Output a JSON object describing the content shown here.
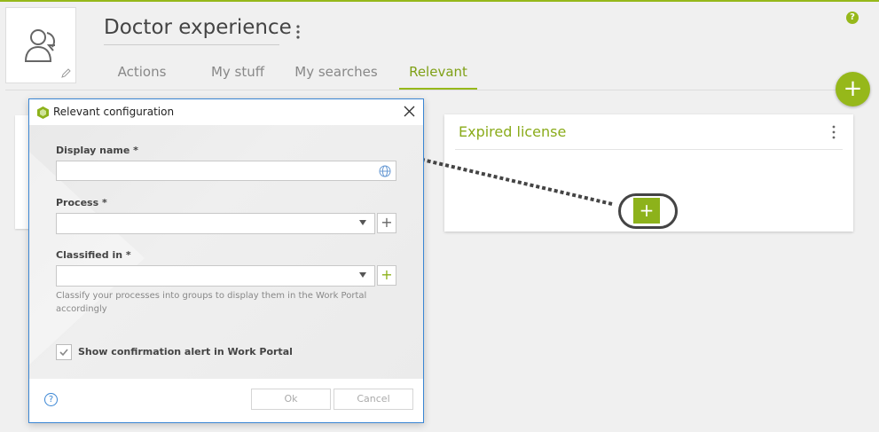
{
  "header": {
    "title": "Doctor experience",
    "help_glyph": "?",
    "tabs": [
      {
        "label": "Actions",
        "active": false
      },
      {
        "label": "My stuff",
        "active": false
      },
      {
        "label": "My searches",
        "active": false
      },
      {
        "label": "Relevant",
        "active": true
      }
    ],
    "add_glyph": "+"
  },
  "card": {
    "title": "Expired license",
    "add_glyph": "+"
  },
  "dialog": {
    "title": "Relevant configuration",
    "fields": {
      "display_name": {
        "label": "Display name *",
        "value": ""
      },
      "process": {
        "label": "Process *",
        "value": "",
        "add_glyph": "+"
      },
      "classified_in": {
        "label": "Classified in *",
        "value": "",
        "add_glyph": "+",
        "helper": "Classify your processes into groups to display them in the Work Portal accordingly"
      }
    },
    "checkbox": {
      "label": "Show confirmation alert in Work Portal",
      "checked": true
    },
    "help_glyph": "?",
    "ok_label": "Ok",
    "cancel_label": "Cancel"
  },
  "colors": {
    "accent": "#96b81a",
    "dialog_border": "#3a86d4"
  },
  "icons": [
    "user-icon",
    "pencil-icon",
    "kebab-icon",
    "help-icon",
    "plus-icon",
    "logo-icon",
    "close-icon",
    "globe-icon",
    "caret-down-icon",
    "check-icon"
  ]
}
